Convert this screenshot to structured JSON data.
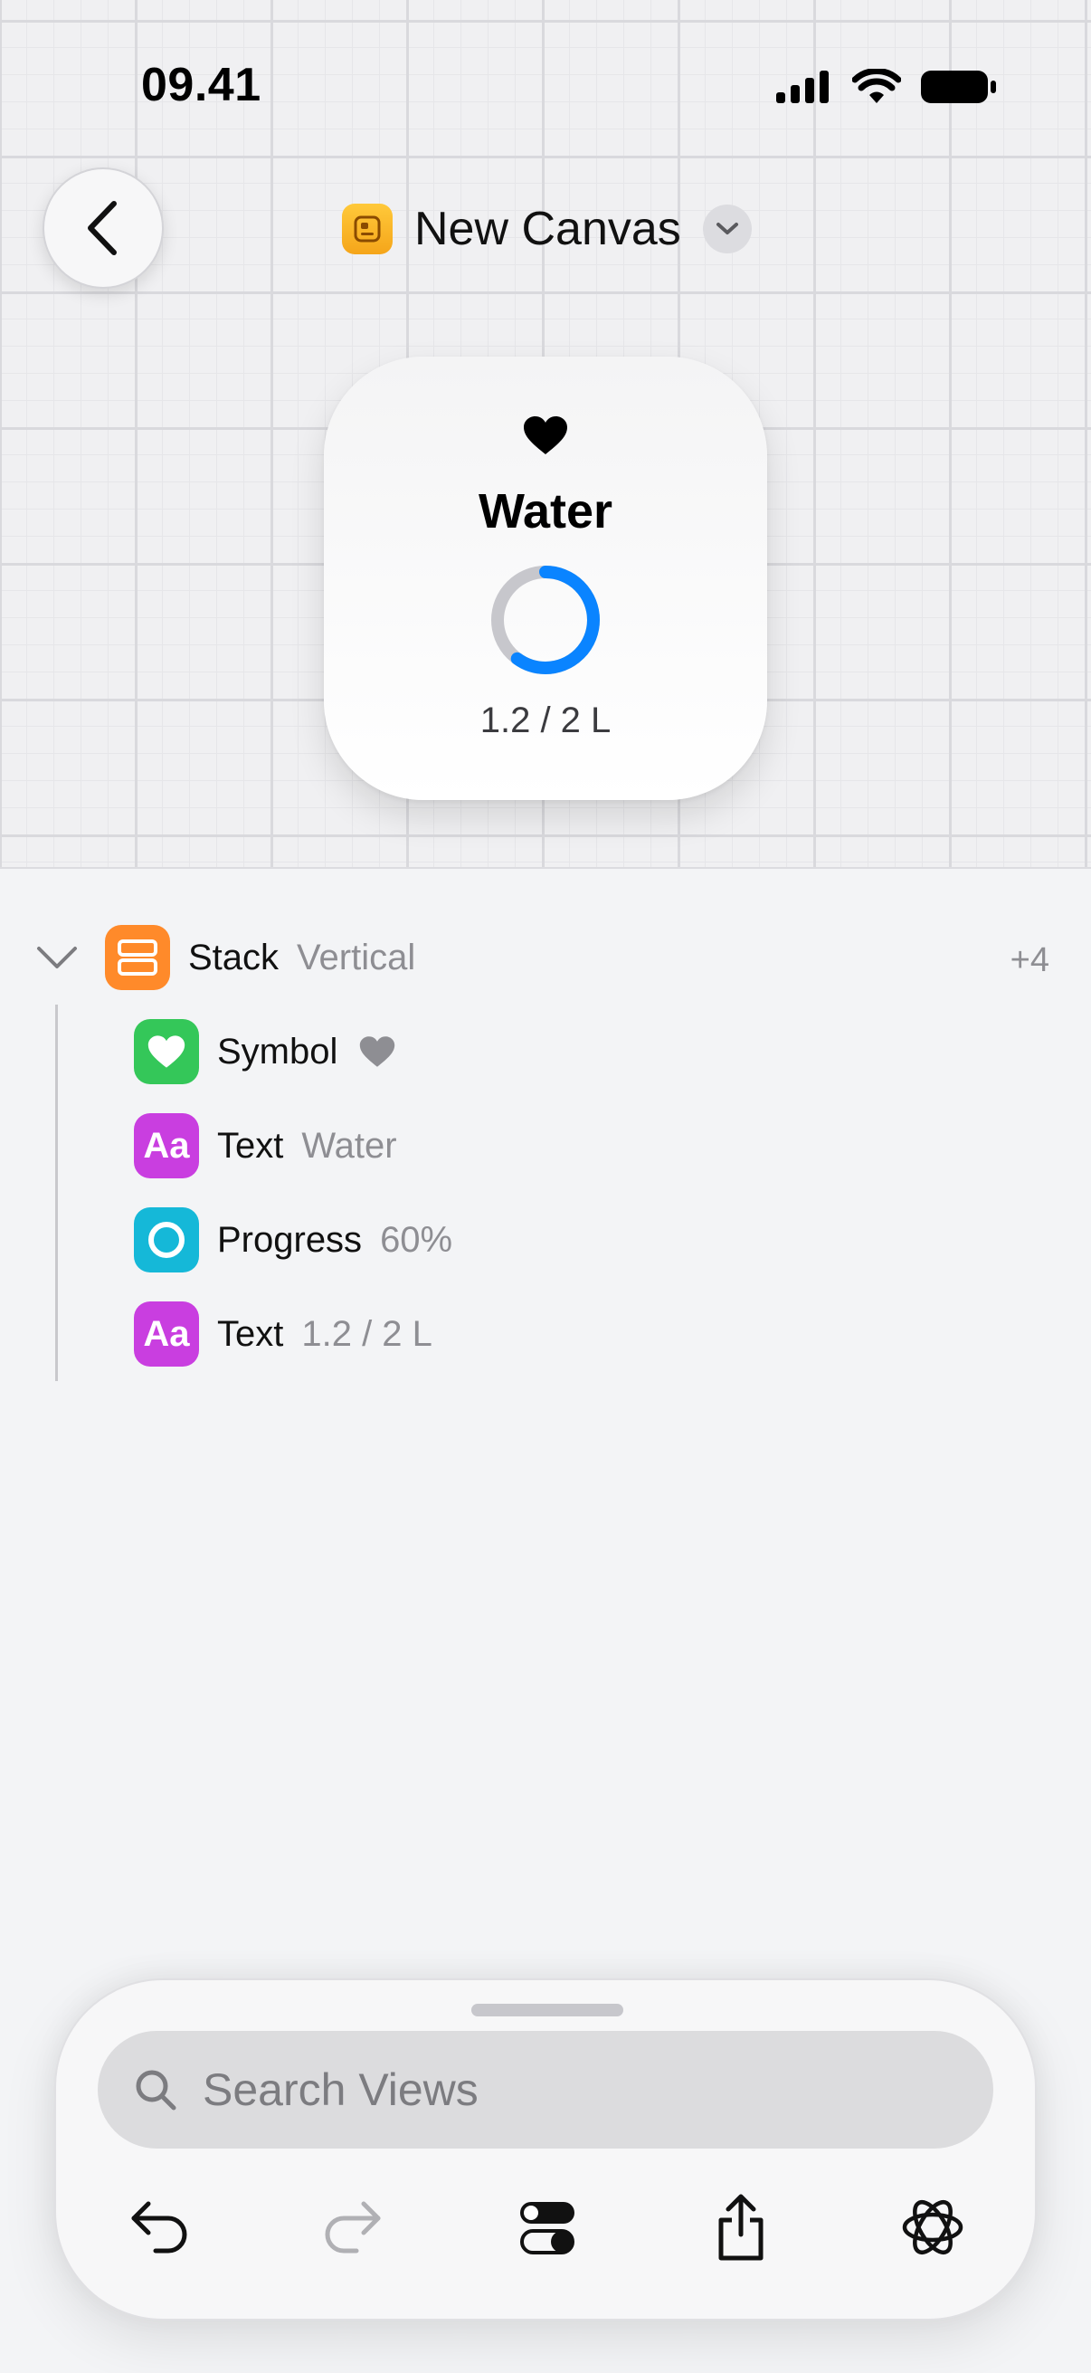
{
  "status_bar": {
    "time": "09.41"
  },
  "header": {
    "title": "New Canvas"
  },
  "widget": {
    "title": "Water",
    "value_text": "1.2 / 2 L",
    "progress": 0.6,
    "ring_color": "#0a84ff",
    "track_color": "#c7c7cc"
  },
  "tree": {
    "root": {
      "name": "Stack",
      "detail": "Vertical",
      "count": "+4",
      "icon": "stack-icon",
      "color": "#ff8a2a"
    },
    "children": [
      {
        "name": "Symbol",
        "detail": "",
        "icon": "heart-symbol-icon",
        "color": "#34c759"
      },
      {
        "name": "Text",
        "detail": "Water",
        "icon": "text-aa-icon",
        "icon_text": "Aa",
        "color": "#c93ee0"
      },
      {
        "name": "Progress",
        "detail": "60%",
        "icon": "progress-ring-icon",
        "color": "#15b8d8"
      },
      {
        "name": "Text",
        "detail": "1.2 / 2 L",
        "icon": "text-aa-icon",
        "icon_text": "Aa",
        "color": "#c93ee0"
      }
    ]
  },
  "bottom_panel": {
    "search": {
      "placeholder": "Search Views"
    },
    "toolbar": [
      "undo-icon",
      "redo-icon",
      "toggles-icon",
      "share-icon",
      "ai-sparkle-icon"
    ]
  }
}
